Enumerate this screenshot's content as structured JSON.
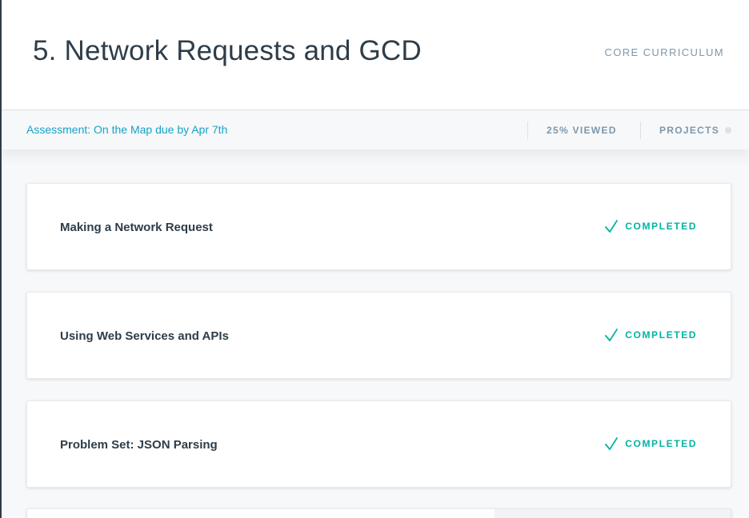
{
  "header": {
    "title": "5. Network Requests and GCD",
    "section_label": "CORE CURRICULUM"
  },
  "subbar": {
    "assessment_link": "Assessment: On the Map due by Apr 7th",
    "viewed": "25% VIEWED",
    "projects_label": "PROJECTS"
  },
  "concepts": [
    {
      "title": "Making a Network Request",
      "status": "COMPLETED"
    },
    {
      "title": "Using Web Services and APIs",
      "status": "COMPLETED"
    },
    {
      "title": "Problem Set: JSON Parsing",
      "status": "COMPLETED"
    }
  ],
  "icons": {
    "status_check": "check-icon",
    "projects_indicator": "dot-icon"
  },
  "colors": {
    "accent": "#15a3c7",
    "completed": "#02b3a4",
    "muted": "#7d97ad",
    "text": "#2e3d49"
  }
}
